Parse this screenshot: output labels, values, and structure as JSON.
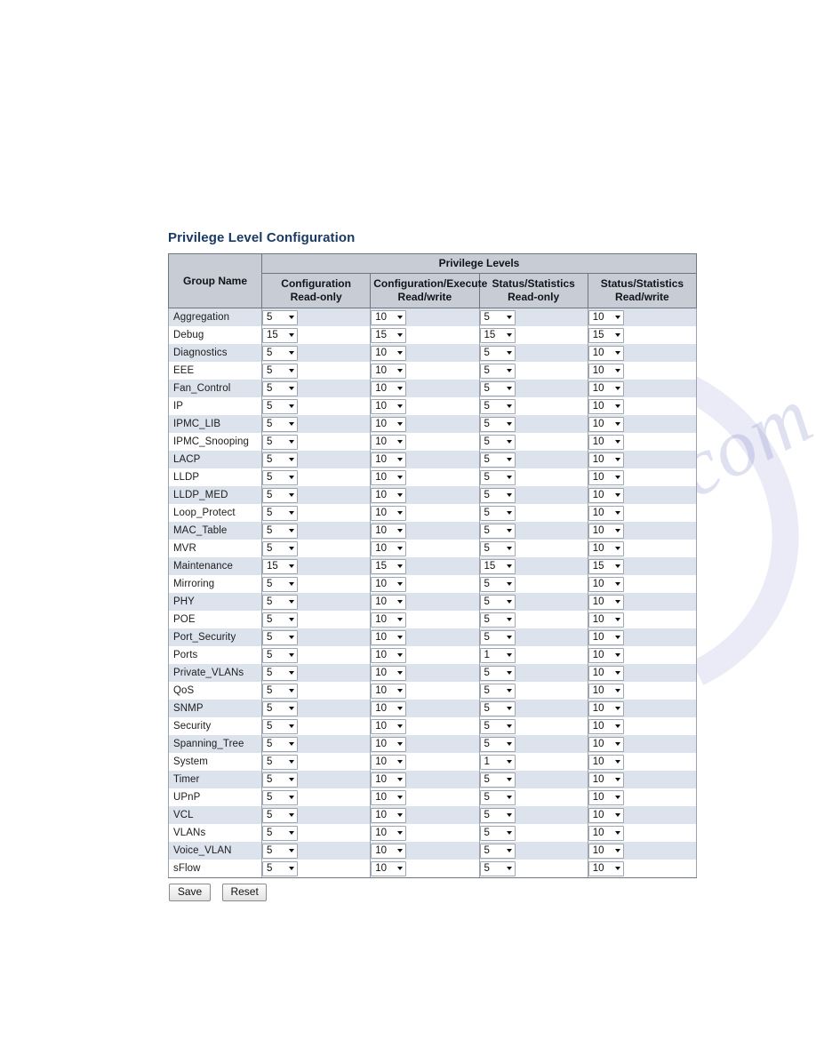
{
  "page": {
    "title": "Privilege Level Configuration",
    "title_color": "#1b3a63"
  },
  "table": {
    "header": {
      "group_name": "Group Name",
      "privilege_levels": "Privilege Levels",
      "columns": [
        {
          "line1": "Configuration",
          "line2": "Read-only"
        },
        {
          "line1": "Configuration/Execute",
          "line2": "Read/write"
        },
        {
          "line1": "Status/Statistics",
          "line2": "Read-only"
        },
        {
          "line1": "Status/Statistics",
          "line2": "Read/write"
        }
      ]
    },
    "rows": [
      {
        "group": "Aggregation",
        "cfg_ro": "5",
        "cfg_rw": "10",
        "st_ro": "5",
        "st_rw": "10"
      },
      {
        "group": "Debug",
        "cfg_ro": "15",
        "cfg_rw": "15",
        "st_ro": "15",
        "st_rw": "15"
      },
      {
        "group": "Diagnostics",
        "cfg_ro": "5",
        "cfg_rw": "10",
        "st_ro": "5",
        "st_rw": "10"
      },
      {
        "group": "EEE",
        "cfg_ro": "5",
        "cfg_rw": "10",
        "st_ro": "5",
        "st_rw": "10"
      },
      {
        "group": "Fan_Control",
        "cfg_ro": "5",
        "cfg_rw": "10",
        "st_ro": "5",
        "st_rw": "10"
      },
      {
        "group": "IP",
        "cfg_ro": "5",
        "cfg_rw": "10",
        "st_ro": "5",
        "st_rw": "10"
      },
      {
        "group": "IPMC_LIB",
        "cfg_ro": "5",
        "cfg_rw": "10",
        "st_ro": "5",
        "st_rw": "10"
      },
      {
        "group": "IPMC_Snooping",
        "cfg_ro": "5",
        "cfg_rw": "10",
        "st_ro": "5",
        "st_rw": "10"
      },
      {
        "group": "LACP",
        "cfg_ro": "5",
        "cfg_rw": "10",
        "st_ro": "5",
        "st_rw": "10"
      },
      {
        "group": "LLDP",
        "cfg_ro": "5",
        "cfg_rw": "10",
        "st_ro": "5",
        "st_rw": "10"
      },
      {
        "group": "LLDP_MED",
        "cfg_ro": "5",
        "cfg_rw": "10",
        "st_ro": "5",
        "st_rw": "10"
      },
      {
        "group": "Loop_Protect",
        "cfg_ro": "5",
        "cfg_rw": "10",
        "st_ro": "5",
        "st_rw": "10"
      },
      {
        "group": "MAC_Table",
        "cfg_ro": "5",
        "cfg_rw": "10",
        "st_ro": "5",
        "st_rw": "10"
      },
      {
        "group": "MVR",
        "cfg_ro": "5",
        "cfg_rw": "10",
        "st_ro": "5",
        "st_rw": "10"
      },
      {
        "group": "Maintenance",
        "cfg_ro": "15",
        "cfg_rw": "15",
        "st_ro": "15",
        "st_rw": "15"
      },
      {
        "group": "Mirroring",
        "cfg_ro": "5",
        "cfg_rw": "10",
        "st_ro": "5",
        "st_rw": "10"
      },
      {
        "group": "PHY",
        "cfg_ro": "5",
        "cfg_rw": "10",
        "st_ro": "5",
        "st_rw": "10"
      },
      {
        "group": "POE",
        "cfg_ro": "5",
        "cfg_rw": "10",
        "st_ro": "5",
        "st_rw": "10"
      },
      {
        "group": "Port_Security",
        "cfg_ro": "5",
        "cfg_rw": "10",
        "st_ro": "5",
        "st_rw": "10"
      },
      {
        "group": "Ports",
        "cfg_ro": "5",
        "cfg_rw": "10",
        "st_ro": "1",
        "st_rw": "10"
      },
      {
        "group": "Private_VLANs",
        "cfg_ro": "5",
        "cfg_rw": "10",
        "st_ro": "5",
        "st_rw": "10"
      },
      {
        "group": "QoS",
        "cfg_ro": "5",
        "cfg_rw": "10",
        "st_ro": "5",
        "st_rw": "10"
      },
      {
        "group": "SNMP",
        "cfg_ro": "5",
        "cfg_rw": "10",
        "st_ro": "5",
        "st_rw": "10"
      },
      {
        "group": "Security",
        "cfg_ro": "5",
        "cfg_rw": "10",
        "st_ro": "5",
        "st_rw": "10"
      },
      {
        "group": "Spanning_Tree",
        "cfg_ro": "5",
        "cfg_rw": "10",
        "st_ro": "5",
        "st_rw": "10"
      },
      {
        "group": "System",
        "cfg_ro": "5",
        "cfg_rw": "10",
        "st_ro": "1",
        "st_rw": "10"
      },
      {
        "group": "Timer",
        "cfg_ro": "5",
        "cfg_rw": "10",
        "st_ro": "5",
        "st_rw": "10"
      },
      {
        "group": "UPnP",
        "cfg_ro": "5",
        "cfg_rw": "10",
        "st_ro": "5",
        "st_rw": "10"
      },
      {
        "group": "VCL",
        "cfg_ro": "5",
        "cfg_rw": "10",
        "st_ro": "5",
        "st_rw": "10"
      },
      {
        "group": "VLANs",
        "cfg_ro": "5",
        "cfg_rw": "10",
        "st_ro": "5",
        "st_rw": "10"
      },
      {
        "group": "Voice_VLAN",
        "cfg_ro": "5",
        "cfg_rw": "10",
        "st_ro": "5",
        "st_rw": "10"
      },
      {
        "group": "sFlow",
        "cfg_ro": "5",
        "cfg_rw": "10",
        "st_ro": "5",
        "st_rw": "10"
      }
    ]
  },
  "buttons": {
    "save": "Save",
    "reset": "Reset"
  },
  "watermark": {
    "text": "manualshive.com"
  }
}
